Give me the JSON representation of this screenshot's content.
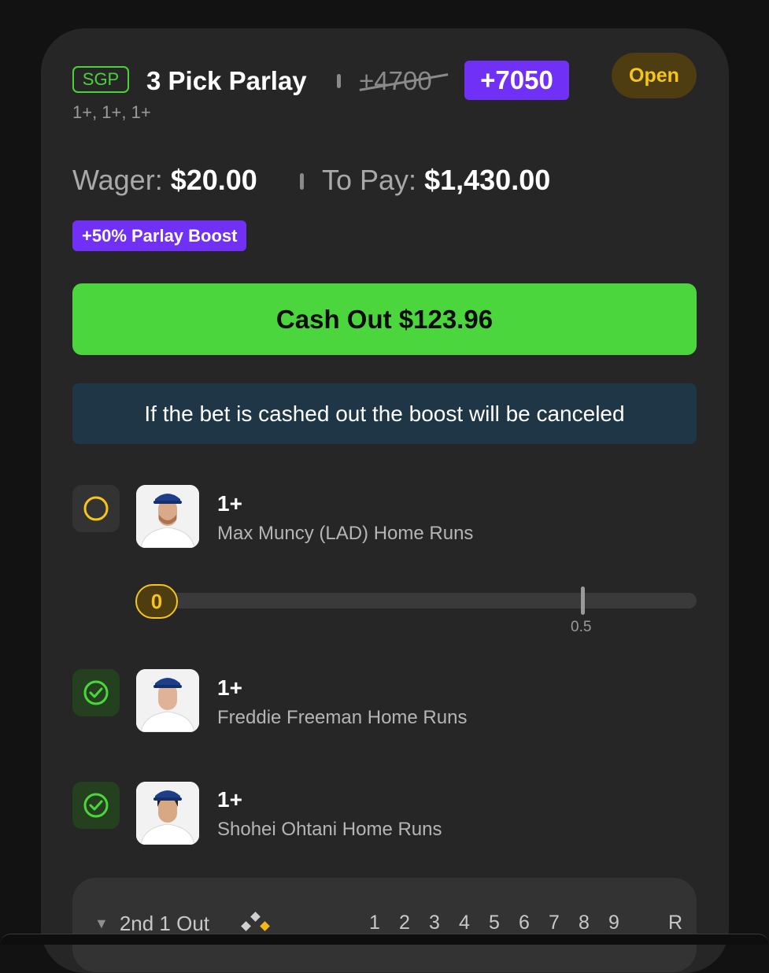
{
  "bet": {
    "badge": "SGP",
    "title": "3 Pick Parlay",
    "old_odds": "+4700",
    "new_odds": "+7050",
    "status": "Open",
    "subtitle": "1+, 1+, 1+"
  },
  "wager": {
    "wager_label": "Wager:",
    "wager_value": "$20.00",
    "pay_label": "To Pay:",
    "pay_value": "$1,430.00"
  },
  "boost": {
    "label": "+50% Parlay Boost"
  },
  "cashout": {
    "label": "Cash Out $123.96"
  },
  "notice": {
    "text": "If the bet is cashed out the boost will be canceled"
  },
  "legs": [
    {
      "line": "1+",
      "desc": "Max Muncy (LAD) Home Runs",
      "status": "pending",
      "progress": {
        "current": "0",
        "target": "0.5"
      }
    },
    {
      "line": "1+",
      "desc": "Freddie Freeman Home Runs",
      "status": "won"
    },
    {
      "line": "1+",
      "desc": "Shohei Ohtani Home Runs",
      "status": "won"
    }
  ],
  "game": {
    "inning": "2nd 1 Out",
    "innings": [
      "1",
      "2",
      "3",
      "4",
      "5",
      "6",
      "7",
      "8",
      "9",
      "R"
    ]
  },
  "colors": {
    "accent_green": "#4cd63e",
    "boost_purple": "#7030f5",
    "open_yellow": "#f5c518",
    "card_bg": "#262626"
  },
  "icons": {
    "pending": "pending-circle-icon",
    "won": "check-circle-icon",
    "expand": "triangle-down-icon",
    "bases": "bases-diamond-icon"
  }
}
